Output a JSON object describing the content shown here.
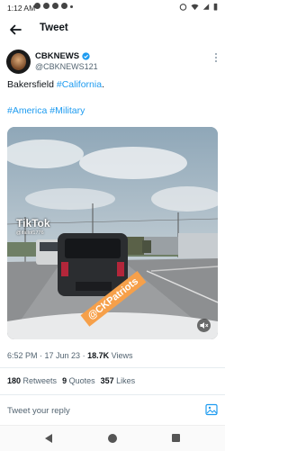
{
  "status_bar": {
    "time": "1:12 AM"
  },
  "header": {
    "title": "Tweet",
    "back_icon": "arrow-left-icon"
  },
  "author": {
    "name": "CBKNEWS",
    "handle": "@CBKNEWS121",
    "verified_icon": "verified-badge-icon"
  },
  "tweet": {
    "line1_plain": "Bakersfield ",
    "line1_link": "#California",
    "line1_end": ".",
    "hashtag1": "#America",
    "hashtag2": "#Military"
  },
  "media": {
    "watermark": "@CKPatriots",
    "tiktok_logo": "TikTok",
    "tiktok_user": "@ifallof1776"
  },
  "meta": {
    "time": "6:52 PM",
    "sep": " · ",
    "date": "17 Jun 23",
    "sep2": " · ",
    "views_count": "18.7K",
    "views_label": " Views"
  },
  "stats": {
    "retweets_count": "180",
    "retweets_label": " Retweets",
    "quotes_count": "9",
    "quotes_label": " Quotes",
    "likes_count": "357",
    "likes_label": " Likes"
  },
  "reply": {
    "placeholder": "Tweet your reply"
  },
  "colors": {
    "link": "#1d9bf0",
    "watermark": "#f6a04a",
    "text": "#0f1419",
    "muted": "#536471"
  }
}
